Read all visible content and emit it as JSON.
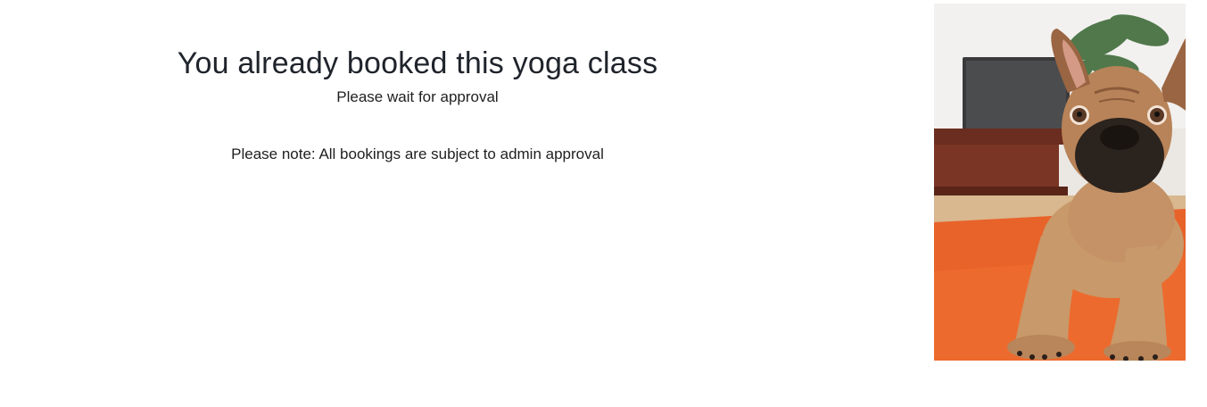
{
  "booking": {
    "title": "You already booked this yoga class",
    "subtitle": "Please wait for approval",
    "note": "Please note: All bookings are subject to admin approval"
  },
  "image": {
    "alt": "French bulldog stretching on an orange yoga mat"
  }
}
